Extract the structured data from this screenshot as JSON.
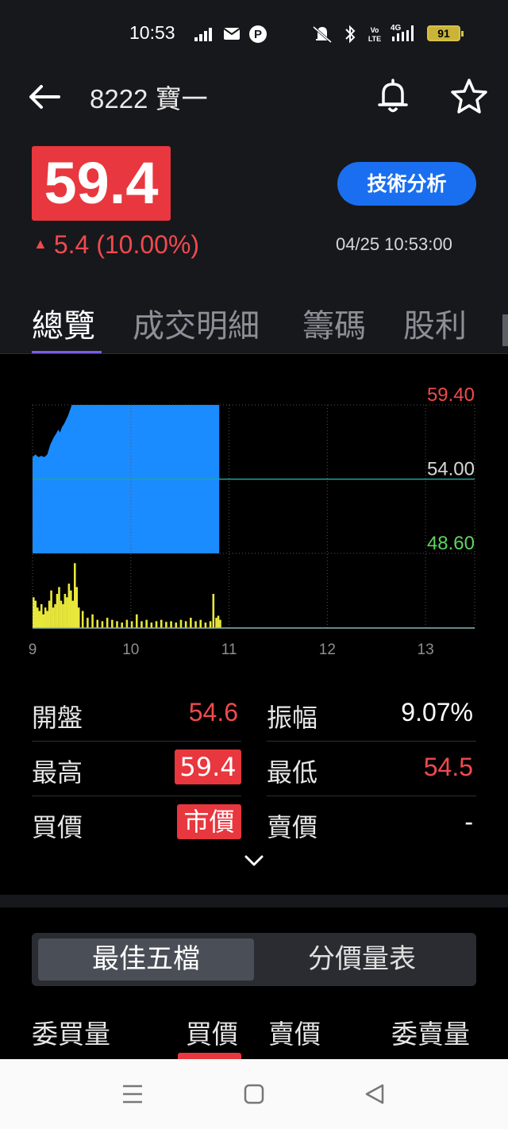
{
  "status_bar": {
    "time": "10:53",
    "battery": "91"
  },
  "header": {
    "title": "8222 寶一",
    "price": "59.4",
    "change": "5.4 (10.00%)",
    "timestamp": "04/25 10:53:00",
    "tech_button": "技術分析"
  },
  "tabs": [
    {
      "label": "總覽",
      "active": true
    },
    {
      "label": "成交明細",
      "active": false
    },
    {
      "label": "籌碼",
      "active": false
    },
    {
      "label": "股利",
      "active": false
    }
  ],
  "colors": {
    "up_red": "#e8373e",
    "price_fill": "#1a8cff",
    "volume": "#e8e83a",
    "reference_line": "#1fa89a",
    "limit_down": "#5fd35f"
  },
  "chart_data": {
    "type": "area",
    "x_ticks": [
      "9",
      "10",
      "11",
      "12",
      "13"
    ],
    "y_labels": [
      {
        "value": "59.40",
        "color": "#f04a4e"
      },
      {
        "value": "54.00",
        "color": "#d8d8d8"
      },
      {
        "value": "48.60",
        "color": "#5fd35f"
      }
    ],
    "ylim": [
      48.6,
      59.4
    ],
    "reference": 54.0,
    "price_series": {
      "time": [
        9.0,
        9.03,
        9.06,
        9.09,
        9.12,
        9.15,
        9.18,
        9.2,
        9.22,
        9.24,
        9.26,
        9.28,
        9.3,
        9.32,
        9.34,
        9.36,
        9.4,
        9.5,
        9.7,
        9.9,
        10.2,
        10.5,
        10.75,
        10.9
      ],
      "values": [
        55.6,
        55.8,
        55.6,
        55.7,
        55.6,
        55.8,
        56.5,
        56.8,
        57.1,
        57.3,
        57.6,
        57.4,
        57.8,
        58.0,
        58.3,
        58.6,
        59.4,
        59.4,
        59.4,
        59.4,
        59.4,
        59.4,
        59.4,
        59.4
      ]
    },
    "volume_series": {
      "time": [
        9.0,
        9.02,
        9.04,
        9.06,
        9.08,
        9.1,
        9.12,
        9.14,
        9.16,
        9.18,
        9.2,
        9.22,
        9.24,
        9.26,
        9.28,
        9.3,
        9.32,
        9.34,
        9.36,
        9.38,
        9.4,
        9.42,
        9.44,
        9.46,
        9.5,
        9.55,
        9.6,
        9.65,
        9.7,
        9.75,
        9.8,
        9.85,
        9.9,
        9.95,
        10.0,
        10.05,
        10.1,
        10.15,
        10.2,
        10.25,
        10.3,
        10.35,
        10.4,
        10.45,
        10.5,
        10.55,
        10.6,
        10.65,
        10.7,
        10.75,
        10.8,
        10.83,
        10.86,
        10.88,
        10.9
      ],
      "values": [
        45,
        40,
        30,
        25,
        35,
        20,
        30,
        25,
        40,
        55,
        30,
        35,
        50,
        60,
        40,
        35,
        50,
        45,
        65,
        55,
        40,
        95,
        60,
        30,
        25,
        15,
        20,
        12,
        10,
        15,
        12,
        10,
        8,
        12,
        10,
        20,
        10,
        12,
        8,
        10,
        12,
        9,
        10,
        8,
        12,
        10,
        15,
        10,
        12,
        8,
        10,
        50,
        15,
        18,
        12
      ],
      "vmax": 100
    }
  },
  "stats": {
    "open_label": "開盤",
    "open_value": "54.6",
    "amplitude_label": "振幅",
    "amplitude_value": "9.07%",
    "high_label": "最高",
    "high_value": "59.4",
    "low_label": "最低",
    "low_value": "54.5",
    "bid_label": "買價",
    "bid_value": "市價",
    "ask_label": "賣價",
    "ask_value": "-"
  },
  "order_book": {
    "seg_best5": "最佳五檔",
    "seg_price_volume": "分價量表",
    "col_bid_qty": "委買量",
    "col_bid_price": "買價",
    "col_ask_price": "賣價",
    "col_ask_qty": "委賣量"
  }
}
